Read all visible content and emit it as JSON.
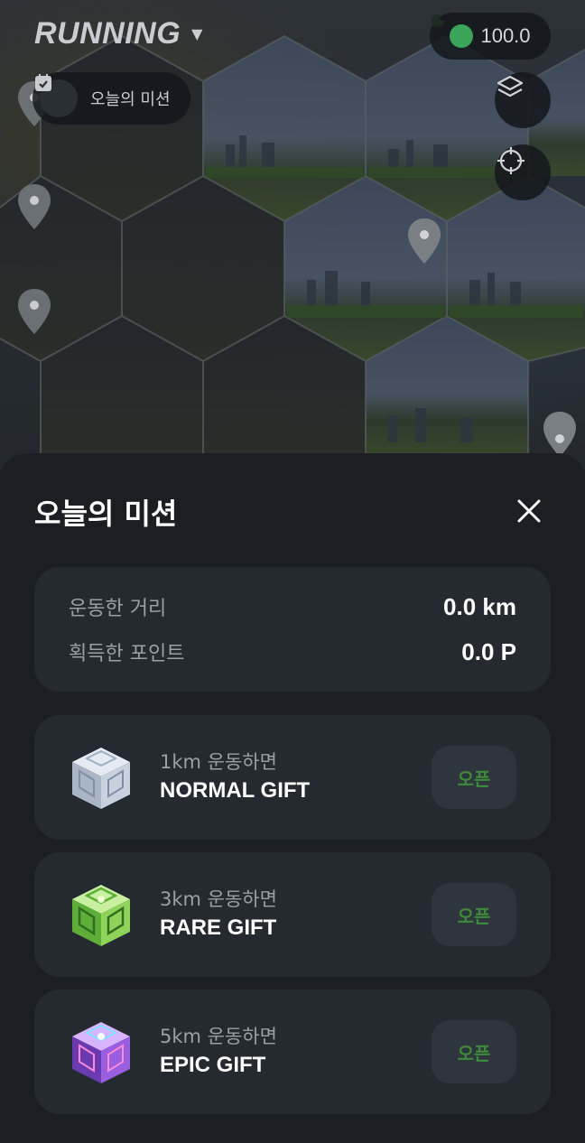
{
  "header": {
    "title": "RUNNING",
    "points": "100.0"
  },
  "mission_chip": {
    "label": "오늘의 미션"
  },
  "sheet": {
    "title": "오늘의 미션",
    "stats": [
      {
        "label": "운동한 거리",
        "value": "0.0 km"
      },
      {
        "label": "획득한 포인트",
        "value": "0.0 P"
      }
    ],
    "gifts": [
      {
        "condition": "1km 운동하면",
        "name": "NORMAL GIFT",
        "button": "오픈"
      },
      {
        "condition": "3km 운동하면",
        "name": "RARE GIFT",
        "button": "오픈"
      },
      {
        "condition": "5km 운동하면",
        "name": "EPIC GIFT",
        "button": "오픈"
      }
    ]
  },
  "colors": {
    "accent_green": "#3aa55a",
    "open_text": "#3f8a3a",
    "sheet_bg": "#1b1f24",
    "card_bg": "#252a31"
  },
  "icons": [
    "chevron-down-icon",
    "coin-icon",
    "checklist-icon",
    "layers-icon",
    "locate-icon",
    "map-pin-icon",
    "close-icon",
    "gift-box-icon"
  ]
}
